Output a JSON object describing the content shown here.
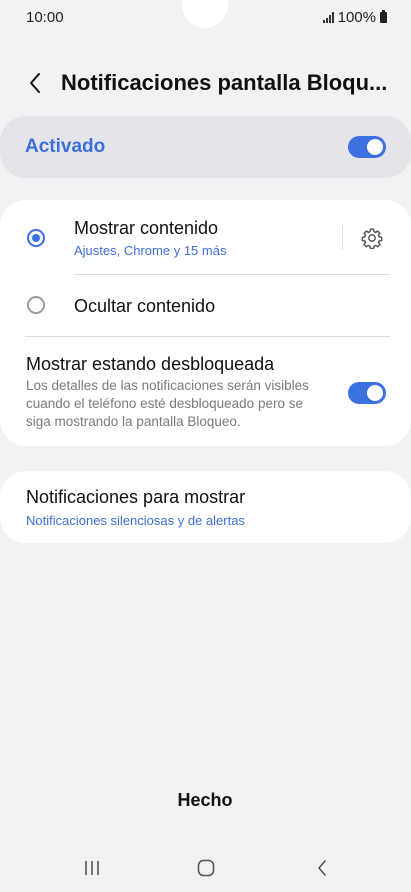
{
  "status_bar": {
    "time": "10:00",
    "battery": "100%"
  },
  "header": {
    "title": "Notificaciones pantalla Bloqu..."
  },
  "master_toggle": {
    "label": "Activado",
    "on": true
  },
  "options": [
    {
      "title": "Mostrar contenido",
      "subtitle": "Ajustes, Chrome y 15 más",
      "selected": true
    },
    {
      "title": "Ocultar contenido",
      "selected": false
    }
  ],
  "show_unlocked": {
    "title": "Mostrar estando desbloqueada",
    "description": "Los detalles de las notificaciones serán visibles cuando el teléfono esté desbloqueado pero se siga mostrando la pantalla Bloqueo.",
    "on": true
  },
  "notifications_to_show": {
    "title": "Notificaciones para mostrar",
    "value": "Notificaciones silenciosas y de alertas"
  },
  "footer": {
    "done_label": "Hecho"
  },
  "colors": {
    "accent": "#3d70e0",
    "background": "#f2f2f4",
    "card": "#ffffff",
    "highlight_row": "#e4e5ea"
  },
  "icons": [
    "signal-icon",
    "battery-icon",
    "back-arrow-icon",
    "gear-icon",
    "recents-icon",
    "home-icon",
    "nav-back-icon"
  ]
}
